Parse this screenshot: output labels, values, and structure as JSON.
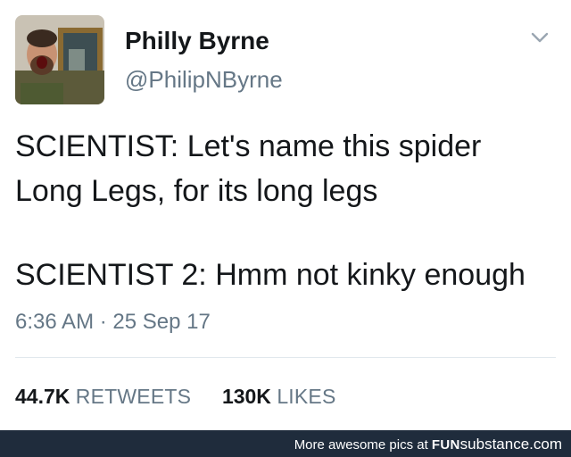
{
  "user": {
    "display_name": "Philly Byrne",
    "handle": "@PhilipNByrne"
  },
  "tweet": {
    "lines": [
      "SCIENTIST: Let's name this spider",
      "Long Legs, for its long legs",
      "SCIENTIST 2: Hmm not kinky enough"
    ],
    "timestamp": "6:36 AM · 25 Sep 17"
  },
  "stats": {
    "retweets_count": "44.7K",
    "retweets_label": "RETWEETS",
    "likes_count": "130K",
    "likes_label": "LIKES"
  },
  "footer": {
    "prefix": "More awesome pics at ",
    "brand_bold": "FUN",
    "brand_rest": "substance.com"
  },
  "icons": {
    "caret": "chevron-down-icon",
    "avatar": "user-photo"
  },
  "colors": {
    "text": "#14171a",
    "muted": "#657786",
    "divider": "#e1e8ed",
    "footer_bg": "#1f2c3c"
  }
}
